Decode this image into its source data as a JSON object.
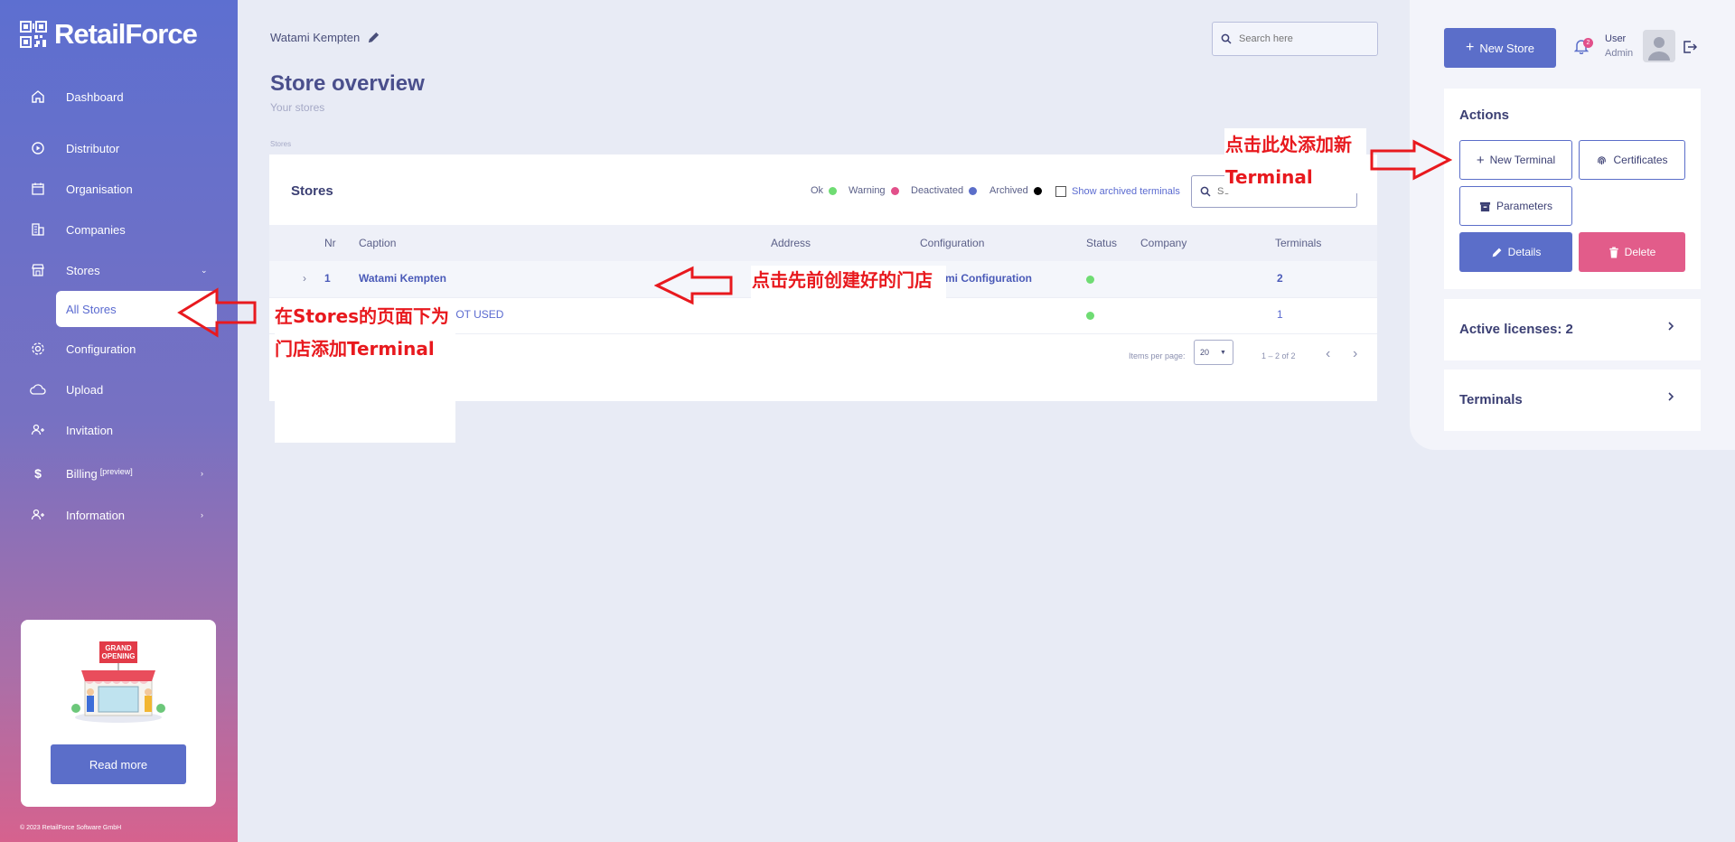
{
  "app": {
    "logo_text": "RetailForce"
  },
  "sidebar": {
    "items": [
      {
        "label": "Dashboard",
        "icon": "home-icon"
      },
      {
        "label": "Distributor",
        "icon": "play-circle-icon"
      },
      {
        "label": "Organisation",
        "icon": "calendar-icon"
      },
      {
        "label": "Companies",
        "icon": "building-icon"
      },
      {
        "label": "Stores",
        "icon": "store-icon"
      },
      {
        "label": "Configuration",
        "icon": "gear-icon"
      },
      {
        "label": "Upload",
        "icon": "cloud-icon"
      },
      {
        "label": "Invitation",
        "icon": "user-plus-icon"
      },
      {
        "label": "Billing",
        "superscript": "[preview]",
        "icon": "dollar-icon"
      },
      {
        "label": "Information",
        "icon": "user-plus-icon"
      }
    ],
    "stores_subitem": "All Stores",
    "promo": {
      "sign_line1": "GRAND",
      "sign_line2": "OPENING",
      "button": "Read more"
    },
    "copyright": "© 2023 RetailForce Software GmbH"
  },
  "header": {
    "store_name": "Watami Kempten",
    "search_placeholder": "Search here"
  },
  "page": {
    "title": "Store overview",
    "subtitle": "Your stores",
    "section_label": "Stores"
  },
  "stores_card": {
    "title": "Stores",
    "legend": [
      {
        "label": "Ok",
        "color": "#6fdc73"
      },
      {
        "label": "Warning",
        "color": "#e2508a"
      },
      {
        "label": "Deactivated",
        "color": "#5b6ec9"
      },
      {
        "label": "Archived",
        "color": "#000000"
      }
    ],
    "show_archived": "Show archived terminals",
    "search_placeholder": "Se",
    "columns": [
      "Nr",
      "Caption",
      "Address",
      "Configuration",
      "Status",
      "Company",
      "Terminals"
    ],
    "rows": [
      {
        "nr": "1",
        "caption": "Watami Kempten",
        "configuration": "mi Configuration",
        "terminals": "2"
      },
      {
        "caption_partial": "IOT USED",
        "terminals": "1"
      }
    ],
    "pagination": {
      "items_per_page_label": "Items per page:",
      "items_per_page": "20",
      "range": "1 – 2 of 2"
    }
  },
  "right_panel": {
    "new_store": "New Store",
    "notifications": "2",
    "user": {
      "name": "User",
      "role": "Admin"
    },
    "actions": {
      "title": "Actions",
      "new_terminal": "New Terminal",
      "certificates": "Certificates",
      "parameters": "Parameters",
      "details": "Details",
      "delete": "Delete"
    },
    "active_licenses": "Active licenses: 2",
    "terminals": "Terminals"
  },
  "annotations": {
    "left_line1": "在Stores的页面下为",
    "left_line2": "门店添加Terminal",
    "middle": "点击先前创建好的门店",
    "right_line1": "点击此处添加新",
    "right_line2": "Terminal",
    "color": "#e8191e"
  },
  "colors": {
    "primary": "#5b6ec9",
    "danger": "#e25c8a",
    "ok": "#6fdc73"
  }
}
